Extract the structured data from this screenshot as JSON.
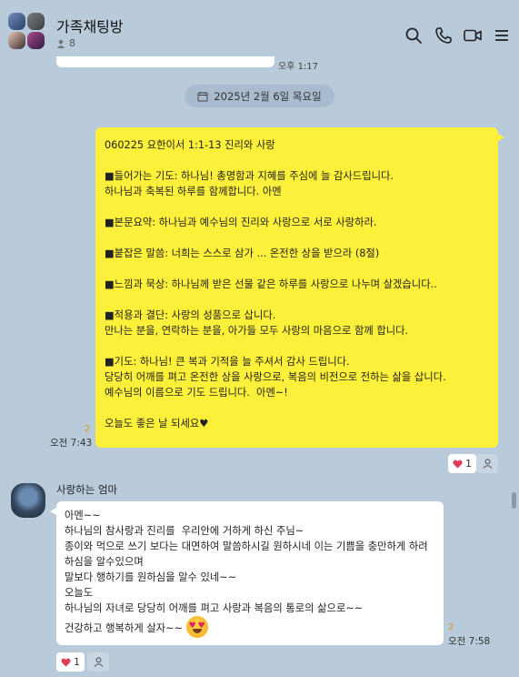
{
  "header": {
    "title": "가족채팅방",
    "member_count": "8",
    "icons": [
      "search-icon",
      "phone-icon",
      "video-icon",
      "menu-icon"
    ]
  },
  "previous_message": {
    "time": "오후 1:17"
  },
  "date_divider": {
    "text": "2025년 2월 6일 목요일"
  },
  "my_message": {
    "text": "060225 요한이서 1:1-13 진리와 사랑\n\n■들어가는 기도: 하나님! 총명함과 지혜를 주심에 늘 감사드립니다.\n하나님과 축복된 하루를 함께합니다. 아멘\n\n■본문요약: 하나님과 예수님의 진리와 사랑으로 서로 사랑하라.\n\n■붙잡은 말씀: 너희는 스스로 삼가 ... 온전한 상을 받으라 (8절)\n\n■느낌과 묵상: 하나님께 받은 선물 같은 하루를 사랑으로 나누며 살겠습니다..\n\n■적용과 결단: 사랑의 성품으로 삽니다.\n만나는 분을, 연락하는 분을, 아가들 모두 사랑의 마음으로 함께 합니다.\n\n■기도: 하나님! 큰 복과 기적을 늘 주셔서 감사 드립니다.\n당당히 어깨를 펴고 온전한 상을 사랑으로, 복음의 비전으로 전하는 삶을 삽니다.\n예수님의 이름으로 기도 드립니다.  아멘~!\n\n오늘도 좋은 날 되세요♥",
    "unread": "2",
    "time": "오전 7:43",
    "reaction_count": "1"
  },
  "other_message": {
    "sender": "사랑하는 엄마",
    "text": "아멘~~\n하나님의 참사랑과 진리를  우리안에 거하게 하신 주님~\n종이와 먹으로 쓰기 보다는 대면하여 말씀하시길 원하시네 이는 기쁨을 충만하게 하려하심을 알수있으며\n말보다 행하기를 원하심을 알수 있네~~\n오늘도\n하나님의 자녀로 당당히 어깨를 펴고 사랑과 복음의 통로의 삶으로~~\n건강하고 행복하게 살자~~",
    "emoji": "smiling-face-with-heart-eyes",
    "unread": "2",
    "time": "오전 7:58",
    "reaction_count": "1"
  }
}
